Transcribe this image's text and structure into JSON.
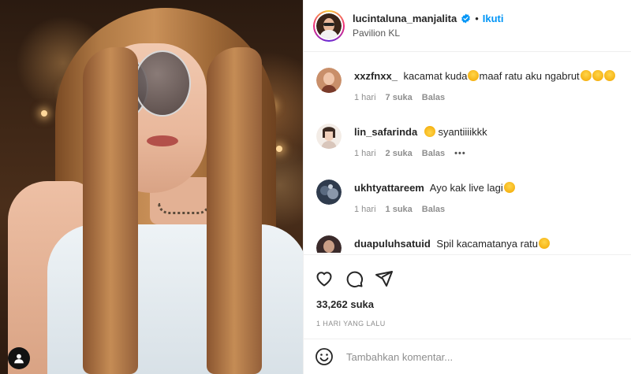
{
  "post": {
    "username": "lucintaluna_manjalita",
    "separator": "•",
    "follow_label": "Ikuti",
    "location": "Pavilion KL",
    "likes": "33,262 suka",
    "timestamp": "1 HARI YANG LALU"
  },
  "comments": [
    {
      "username": "xxzfnxx_",
      "text": "kacamat kuda",
      "text2": "maaf ratu aku ngabrut",
      "time": "1 hari",
      "likes": "7 suka",
      "reply": "Balas",
      "emojis_mid": [
        "crying-emoji"
      ],
      "emojis_end": [
        "crying-emoji",
        "crying-emoji",
        "crying-emoji"
      ]
    },
    {
      "username": "lin_safarinda",
      "text": "syantiiiikkk",
      "time": "1 hari",
      "likes": "2 suka",
      "reply": "Balas",
      "more": "•••",
      "emojis_pre": [
        "sunglasses-emoji"
      ]
    },
    {
      "username": "ukhtyattareem",
      "text": "Ayo kak live lagi",
      "time": "1 hari",
      "likes": "1 suka",
      "reply": "Balas",
      "emojis_end": [
        "heart-eyes-emoji"
      ]
    },
    {
      "username": "duapuluhsatuid",
      "text": "Spil kacamatanya ratu",
      "emojis_end": [
        "heart-eyes-emoji"
      ]
    }
  ],
  "composer": {
    "placeholder": "Tambahkan komentar..."
  },
  "colors": {
    "accent": "#0095f6",
    "verified": "#0095f6",
    "text": "#262626",
    "muted": "#8e8e8e",
    "border": "#efefef"
  },
  "icons": {
    "like": "heart-icon",
    "comment": "comment-icon",
    "share": "share-icon",
    "emoji": "emoji-icon",
    "profile": "user-icon"
  }
}
